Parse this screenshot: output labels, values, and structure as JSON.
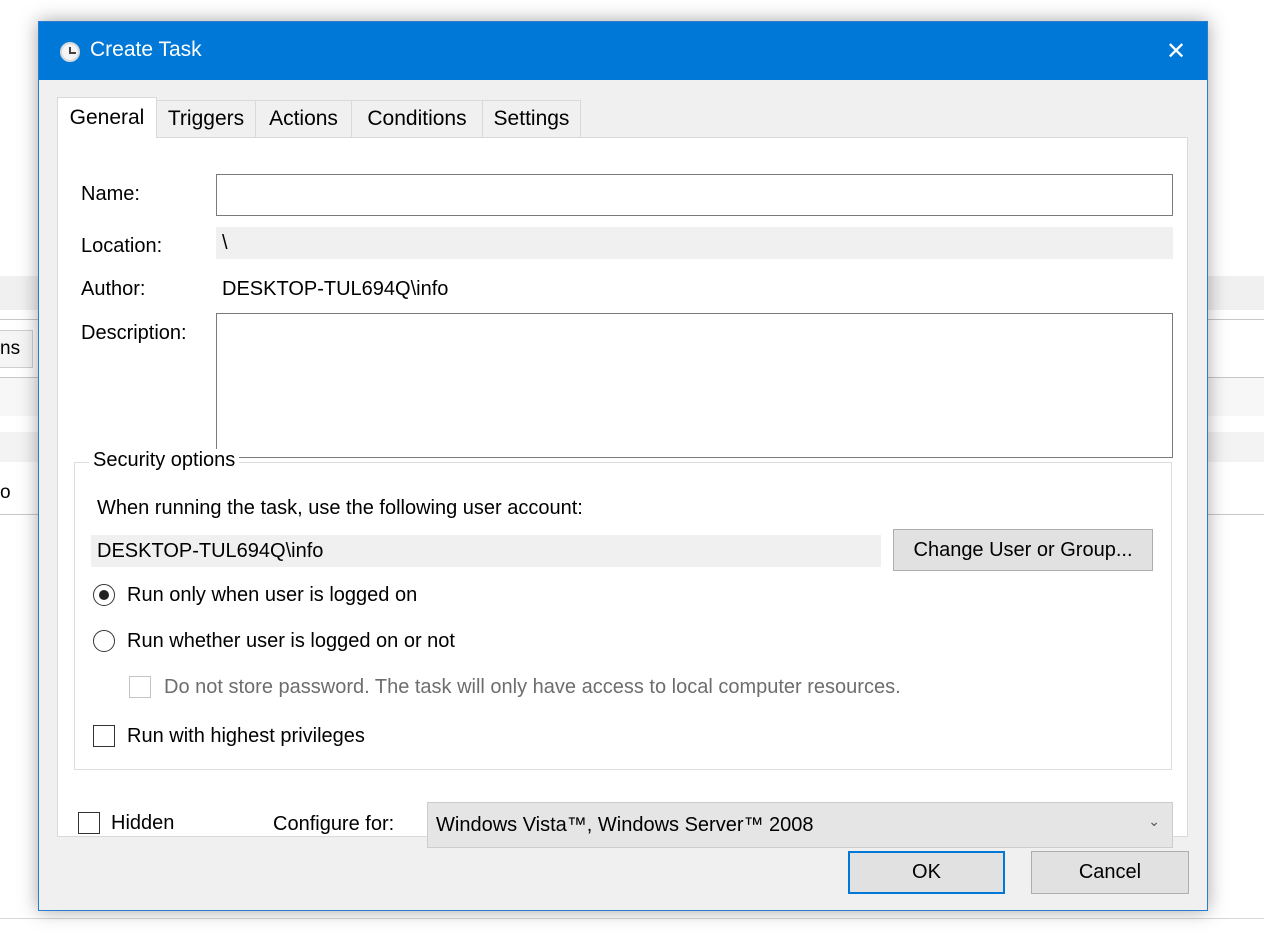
{
  "background": {
    "left_tab_fragment": "ns",
    "left_row_fragment": "o"
  },
  "dialog": {
    "title": "Create Task",
    "close_glyph": "✕"
  },
  "tabs": [
    {
      "label": "General"
    },
    {
      "label": "Triggers"
    },
    {
      "label": "Actions"
    },
    {
      "label": "Conditions"
    },
    {
      "label": "Settings"
    }
  ],
  "general": {
    "name_label": "Name:",
    "name_value": "",
    "location_label": "Location:",
    "location_value": "\\",
    "author_label": "Author:",
    "author_value": "DESKTOP-TUL694Q\\info",
    "description_label": "Description:",
    "description_value": ""
  },
  "security": {
    "group_title": "Security options",
    "account_prompt": "When running the task, use the following user account:",
    "account_value": "DESKTOP-TUL694Q\\info",
    "change_user_button": "Change User or Group...",
    "run_logged_on": "Run only when user is logged on",
    "run_whether": "Run whether user is logged on or not",
    "do_not_store": "Do not store password.  The task will only have access to local computer resources.",
    "run_highest": "Run with highest privileges"
  },
  "bottom": {
    "hidden_label": "Hidden",
    "configure_label": "Configure for:",
    "configure_value": "Windows Vista™, Windows Server™ 2008",
    "dropdown_glyph": "⌄"
  },
  "buttons": {
    "ok": "OK",
    "cancel": "Cancel"
  }
}
